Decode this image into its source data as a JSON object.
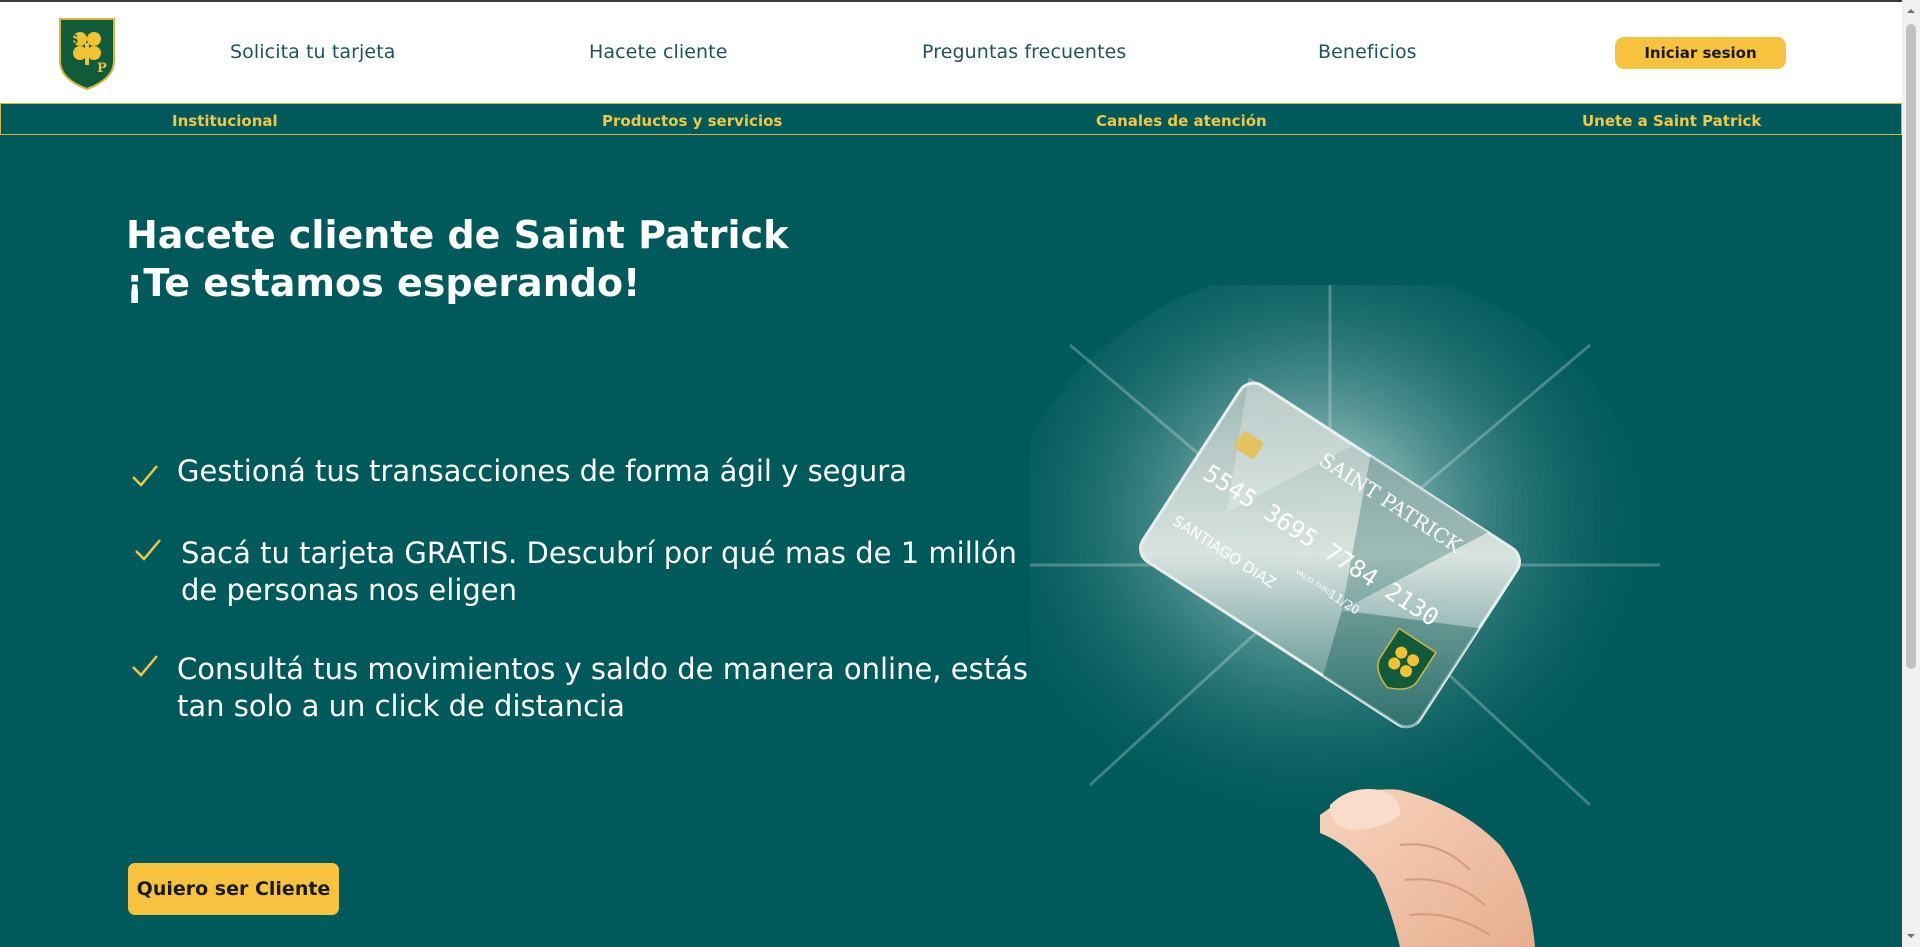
{
  "brand": {
    "logo_text": "SP",
    "logo_colors": {
      "green": "#0f5b3a",
      "gold": "#f2c232"
    }
  },
  "header": {
    "nav": [
      {
        "label": "Solicita tu tarjeta"
      },
      {
        "label": "Hacete cliente"
      },
      {
        "label": "Preguntas frecuentes"
      },
      {
        "label": "Beneficios"
      }
    ],
    "login_label": "Iniciar sesion"
  },
  "subnav": {
    "items": [
      {
        "label": "Institucional"
      },
      {
        "label": "Productos y servicios"
      },
      {
        "label": "Canales de atención"
      },
      {
        "label": "Unete a Saint Patrick"
      }
    ]
  },
  "hero": {
    "title_line1": "Hacete cliente de Saint Patrick",
    "title_line2": "¡Te estamos esperando!",
    "benefits": [
      {
        "text_line1": "Gestioná tus transacciones de forma ágil y segura",
        "text_line2": ""
      },
      {
        "text_line1": "Sacá tu tarjeta GRATIS. Descubrí por qué mas de 1 millón",
        "text_line2": "de personas nos eligen"
      },
      {
        "text_line1": "Consultá tus movimientos y saldo de manera online, estás",
        "text_line2": "tan solo a un click de distancia"
      }
    ],
    "cta_label": "Quiero ser Cliente",
    "card": {
      "brand": "SAINT PATRICK",
      "number": "5545 3695 7784 2130",
      "holder": "SANTIAGO DIAZ",
      "valid_label": "VALID THRU",
      "valid": "11/20"
    }
  },
  "colors": {
    "primary": "#00595a",
    "accent": "#f7c33f",
    "nav_text": "#1d5458",
    "subnav_text": "#f2c744",
    "check": "#f2c744"
  },
  "icons": {
    "check": "check-icon",
    "logo": "shield-clover-logo",
    "scroll_up": "chevron-up-icon",
    "scroll_down": "chevron-down-icon"
  }
}
